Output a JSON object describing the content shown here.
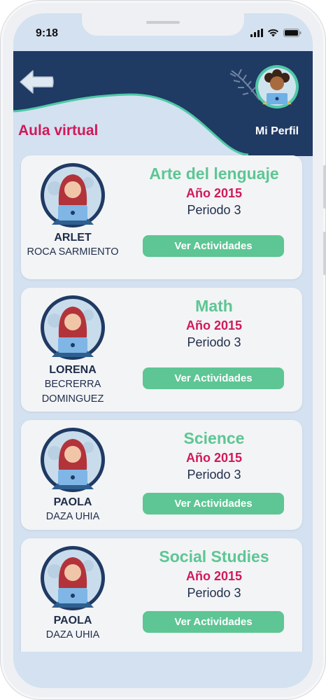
{
  "status_bar": {
    "time": "9:18"
  },
  "header": {
    "title": "Aula virtual",
    "profile_label": "Mi Perfil"
  },
  "colors": {
    "header_navy": "#1f3a63",
    "teal_accent": "#4ec9a6",
    "title_pink": "#d1195a",
    "subject_green": "#5dc694",
    "screen_bg": "#d3e1f0"
  },
  "icons": {
    "back": "arrow-left-icon",
    "signal": "signal-icon",
    "wifi": "wifi-icon",
    "battery": "battery-icon"
  },
  "courses": [
    {
      "teacher_first": "ARLET",
      "teacher_last": "ROCA SARMIENTO",
      "subject": "Arte del lenguaje",
      "year": "Año 2015",
      "period": "Periodo 3",
      "button": "Ver Actividades"
    },
    {
      "teacher_first": "LORENA",
      "teacher_last": "BECRERRA DOMINGUEZ",
      "subject": "Math",
      "year": "Año 2015",
      "period": "Periodo 3",
      "button": "Ver Actividades"
    },
    {
      "teacher_first": "PAOLA",
      "teacher_last": "DAZA UHIA",
      "subject": "Science",
      "year": "Año 2015",
      "period": "Periodo 3",
      "button": "Ver Actividades"
    },
    {
      "teacher_first": "PAOLA",
      "teacher_last": "DAZA UHIA",
      "subject": "Social Studies",
      "year": "Año 2015",
      "period": "Periodo 3",
      "button": "Ver Actividades"
    }
  ]
}
